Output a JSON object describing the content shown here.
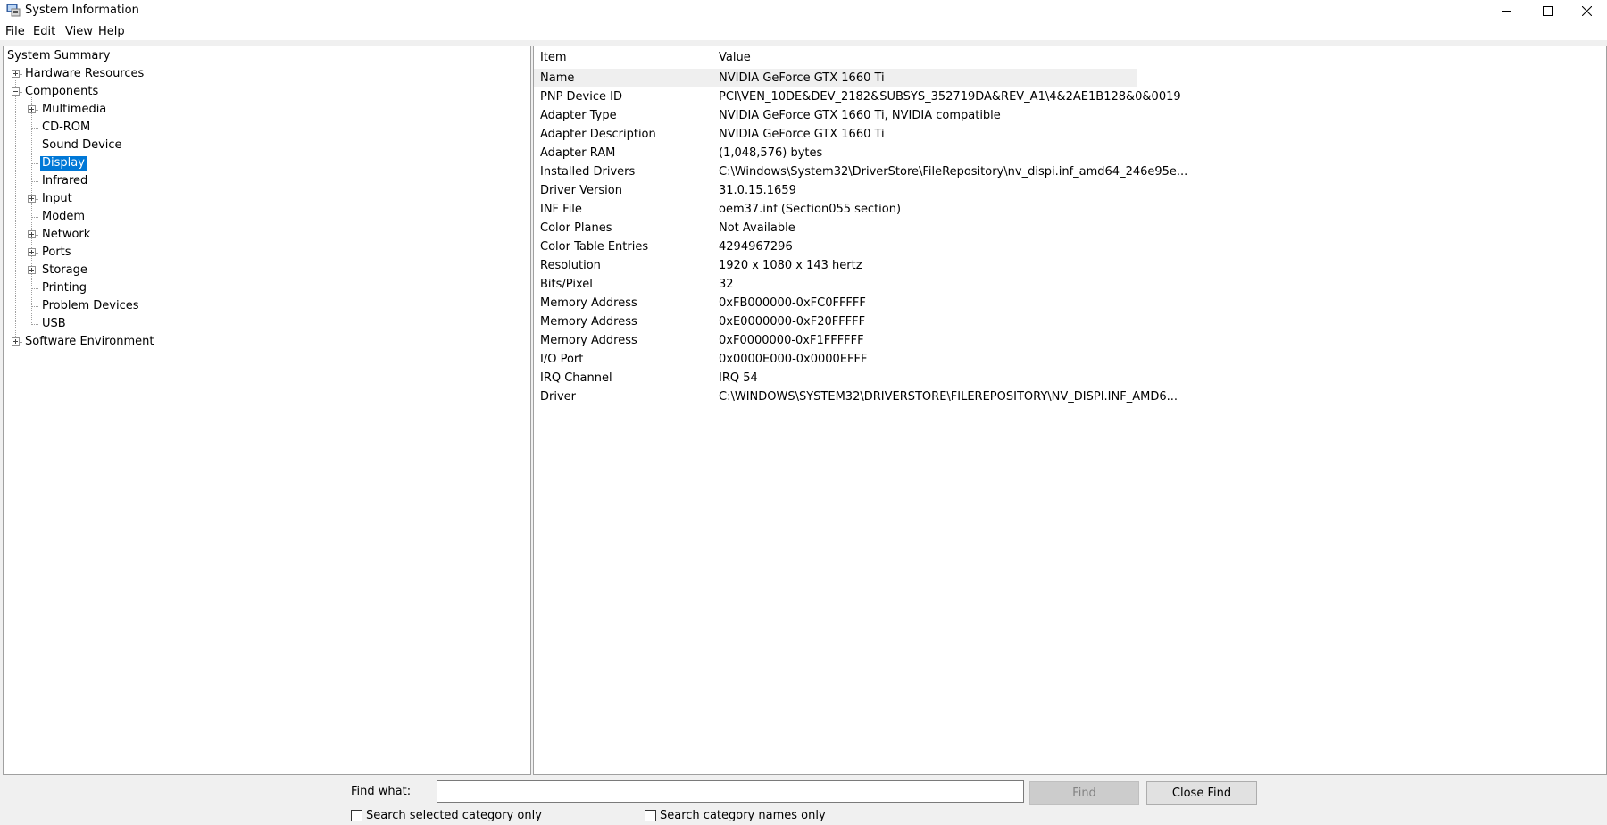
{
  "window": {
    "title": "System Information",
    "minimize": "—",
    "maximize": "☐",
    "close": "✕"
  },
  "menu": [
    "File",
    "Edit",
    "View",
    "Help"
  ],
  "tree": {
    "system_summary": "System Summary",
    "hardware_resources": "Hardware Resources",
    "components": "Components",
    "children": [
      "Multimedia",
      "CD-ROM",
      "Sound Device",
      "Display",
      "Infrared",
      "Input",
      "Modem",
      "Network",
      "Ports",
      "Storage",
      "Printing",
      "Problem Devices",
      "USB"
    ],
    "software_environment": "Software Environment",
    "selected": "Display"
  },
  "table": {
    "headers": [
      "Item",
      "Value"
    ],
    "rows": [
      [
        "Name",
        "NVIDIA GeForce GTX 1660 Ti"
      ],
      [
        "PNP Device ID",
        "PCI\\VEN_10DE&DEV_2182&SUBSYS_352719DA&REV_A1\\4&2AE1B128&0&0019"
      ],
      [
        "Adapter Type",
        "NVIDIA GeForce GTX 1660 Ti, NVIDIA compatible"
      ],
      [
        "Adapter Description",
        "NVIDIA GeForce GTX 1660 Ti"
      ],
      [
        "Adapter RAM",
        "(1,048,576) bytes"
      ],
      [
        "Installed Drivers",
        "C:\\Windows\\System32\\DriverStore\\FileRepository\\nv_dispi.inf_amd64_246e95e..."
      ],
      [
        "Driver Version",
        "31.0.15.1659"
      ],
      [
        "INF File",
        "oem37.inf (Section055 section)"
      ],
      [
        "Color Planes",
        "Not Available"
      ],
      [
        "Color Table Entries",
        "4294967296"
      ],
      [
        "Resolution",
        "1920 x 1080 x 143 hertz"
      ],
      [
        "Bits/Pixel",
        "32"
      ],
      [
        "Memory Address",
        "0xFB000000-0xFC0FFFFF"
      ],
      [
        "Memory Address",
        "0xE0000000-0xF20FFFFF"
      ],
      [
        "Memory Address",
        "0xF0000000-0xF1FFFFFF"
      ],
      [
        "I/O Port",
        "0x0000E000-0x0000EFFF"
      ],
      [
        "IRQ Channel",
        "IRQ 54"
      ],
      [
        "Driver",
        "C:\\WINDOWS\\SYSTEM32\\DRIVERSTORE\\FILEREPOSITORY\\NV_DISPI.INF_AMD6..."
      ]
    ]
  },
  "find": {
    "label": "Find what:",
    "value": "",
    "find_button": "Find",
    "close_button": "Close Find",
    "opt_selected": "Search selected category only",
    "opt_names": "Search category names only"
  }
}
